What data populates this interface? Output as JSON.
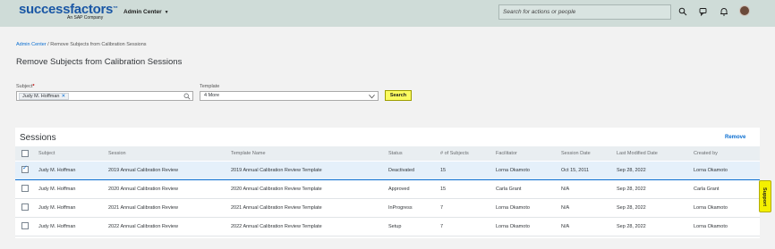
{
  "header": {
    "brand": "successfactors",
    "brand_tm": "™",
    "brand_sub": "An SAP Company",
    "admin_menu_label": "Admin Center",
    "search_placeholder": "Search for actions or people",
    "icons": [
      "search-icon",
      "chat-icon",
      "notifications-icon",
      "avatar"
    ]
  },
  "breadcrumb": {
    "link": "Admin Center",
    "separator": " / ",
    "current": "Remove Subjects from Calibration Sessions"
  },
  "page_title": "Remove Subjects from Calibration Sessions",
  "filters": {
    "subject_label": "Subject",
    "required_marker": "*",
    "subject_token": "Judy M. Hoffman",
    "template_label": "Template",
    "template_value": "4 More",
    "search_button": "Search"
  },
  "sessions": {
    "title": "Sessions",
    "remove_label": "Remove",
    "columns": [
      "Subject",
      "Session",
      "Template Name",
      "Status",
      "# of Subjects",
      "Facilitator",
      "Session Date",
      "Last Modified Date",
      "Created by"
    ],
    "rows": [
      {
        "checked": true,
        "cells": [
          "Judy M. Hoffman",
          "2019 Annual Calibration Review",
          "2019 Annual Calibration Review Template",
          "Deactivated",
          "15",
          "Lorna Okamoto",
          "Oct 15, 2011",
          "Sep 28, 2022",
          "Lorna Okamoto"
        ]
      },
      {
        "checked": false,
        "cells": [
          "Judy M. Hoffman",
          "2020 Annual Calibration Review",
          "2020 Annual Calibration Review Template",
          "Approved",
          "15",
          "Carla Grant",
          "N/A",
          "Sep 28, 2022",
          "Carla Grant"
        ]
      },
      {
        "checked": false,
        "cells": [
          "Judy M. Hoffman",
          "2021 Annual Calibration Review",
          "2021 Annual Calibration Review Template",
          "InProgress",
          "7",
          "Lorna Okamoto",
          "N/A",
          "Sep 28, 2022",
          "Lorna Okamoto"
        ]
      },
      {
        "checked": false,
        "cells": [
          "Judy M. Hoffman",
          "2022 Annual Calibration Review",
          "2022 Annual Calibration Review Template",
          "Setup",
          "7",
          "Lorna Okamoto",
          "N/A",
          "Sep 28, 2022",
          "Lorna Okamoto"
        ]
      }
    ]
  },
  "support_tab": "Support",
  "colors": {
    "brand": "#1a57a5",
    "link": "#0a6ed1",
    "header_bg": "#cfdcd8",
    "search_button": "#fbfb5f",
    "selected_row": "#e5f0fa"
  }
}
